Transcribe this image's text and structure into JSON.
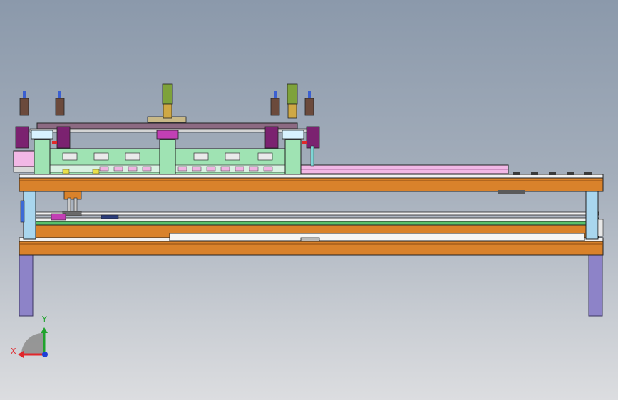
{
  "viewport": {
    "background_top": "#8b99ab",
    "background_bottom": "#dcdde0"
  },
  "triad": {
    "x_label": "X",
    "y_label": "Y",
    "x_color": "#e0262b",
    "y_color": "#1fa32c",
    "z_color": "#1d3fd6"
  },
  "palette": {
    "frame_orange": "#d9822b",
    "leg_purple": "#8d83c8",
    "column_blue": "#a9d6ee",
    "plate_green": "#9fe3b3",
    "rail_pink": "#f2b8e6",
    "cylinder_olive": "#7ea23b",
    "piston_gold": "#cfa844",
    "valve_brown": "#6b4a3c",
    "magenta_block": "#c23fb4"
  }
}
